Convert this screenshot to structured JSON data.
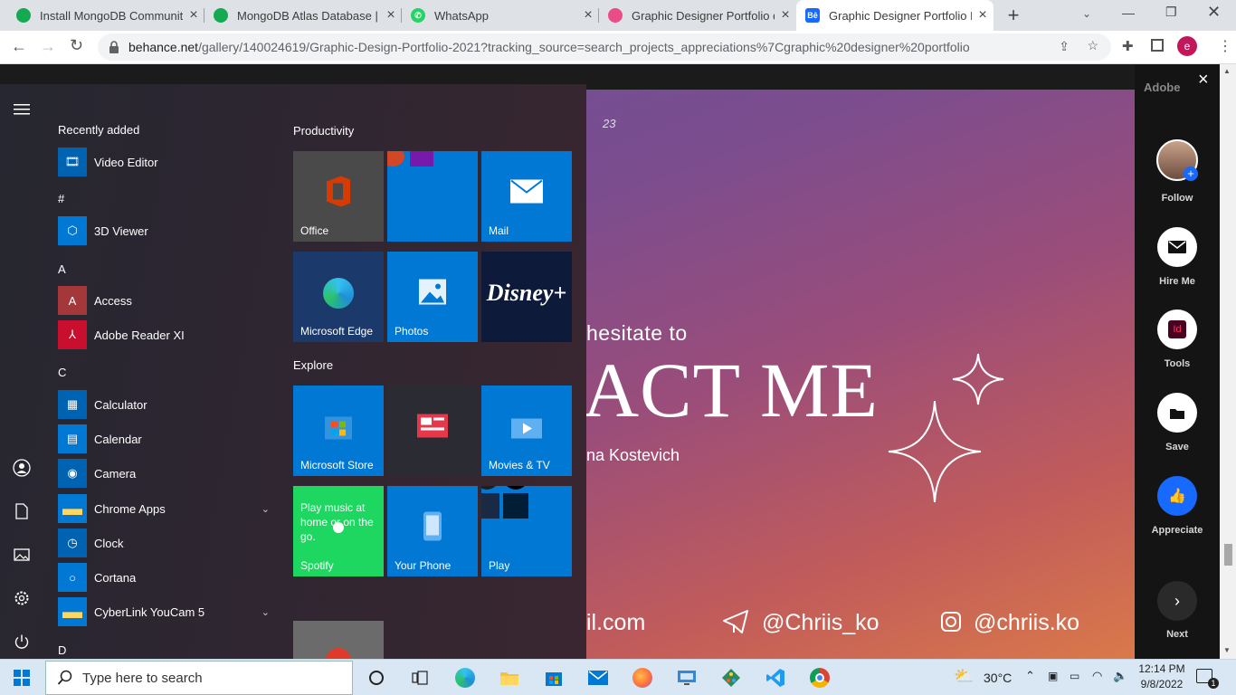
{
  "browser": {
    "tabs": [
      {
        "title": "Install MongoDB Community",
        "icon": "mongodb-leaf-icon",
        "color": "#13aa52"
      },
      {
        "title": "MongoDB Atlas Database | M",
        "icon": "mongodb-leaf-icon",
        "color": "#13aa52"
      },
      {
        "title": "WhatsApp",
        "icon": "whatsapp-icon",
        "color": "#25d366"
      },
      {
        "title": "Graphic Designer Portfolio d",
        "icon": "dribbble-icon",
        "color": "#ea4c89"
      },
      {
        "title": "Graphic Designer Portfolio P",
        "icon": "behance-icon",
        "color": "#1769ff"
      }
    ],
    "url_host": "behance.net",
    "url_path": "/gallery/140024619/Graphic-Design-Portfolio-2021?tracking_source=search_projects_appreciations%7Cgraphic%20designer%20portfolio",
    "profile_initial": "e",
    "profile_color": "#c2185b"
  },
  "artwork": {
    "page_number": "23",
    "line1": "hesitate to",
    "line2": "ACT ME",
    "name": "na Kostevich",
    "email": "il.com",
    "telegram": "@Chriis_ko",
    "instagram": "@chriis.ko"
  },
  "behance_panel": {
    "close": "×",
    "adobe_label": "Adobe",
    "follow": "Follow",
    "hire": "Hire Me",
    "tools": "Tools",
    "tools_badge": "Id",
    "save": "Save",
    "appreciate": "Appreciate",
    "next": "Next"
  },
  "start_menu": {
    "recently_added": "Recently added",
    "apps": [
      {
        "type": "app",
        "label": "Video Editor",
        "icon": "video-editor-icon",
        "color": "#0063b1"
      },
      {
        "type": "letter",
        "label": "#"
      },
      {
        "type": "app",
        "label": "3D Viewer",
        "icon": "cube-icon",
        "color": "#0078d4"
      },
      {
        "type": "letter",
        "label": "A"
      },
      {
        "type": "app",
        "label": "Access",
        "icon": "access-icon",
        "color": "#a4373a"
      },
      {
        "type": "app",
        "label": "Adobe Reader XI",
        "icon": "pdf-icon",
        "color": "#c8102e"
      },
      {
        "type": "letter",
        "label": "C"
      },
      {
        "type": "app",
        "label": "Calculator",
        "icon": "calculator-icon",
        "color": "#0063b1"
      },
      {
        "type": "app",
        "label": "Calendar",
        "icon": "calendar-icon",
        "color": "#0078d4"
      },
      {
        "type": "app",
        "label": "Camera",
        "icon": "camera-icon",
        "color": "#0063b1"
      },
      {
        "type": "app",
        "label": "Chrome Apps",
        "icon": "folder-icon",
        "color": "#0078d4",
        "expand": true
      },
      {
        "type": "app",
        "label": "Clock",
        "icon": "clock-icon",
        "color": "#0063b1"
      },
      {
        "type": "app",
        "label": "Cortana",
        "icon": "cortana-icon",
        "color": "#0078d4"
      },
      {
        "type": "app",
        "label": "CyberLink YouCam 5",
        "icon": "folder-icon",
        "color": "#0078d4",
        "expand": true
      },
      {
        "type": "letter",
        "label": "D"
      }
    ],
    "groups": {
      "productivity": "Productivity",
      "explore": "Explore"
    },
    "tiles": [
      {
        "label": "Office",
        "icon": "office-icon",
        "color": "#4a4a4a"
      },
      {
        "label": "",
        "icon": "office-apps-icon",
        "color": "#0078d4"
      },
      {
        "label": "Mail",
        "icon": "mail-icon",
        "color": "#0078d4"
      },
      {
        "label": "Microsoft Edge",
        "icon": "edge-icon",
        "color": "#1b3a6b"
      },
      {
        "label": "Photos",
        "icon": "photos-icon",
        "color": "#0078d4"
      },
      {
        "label": "",
        "icon": "disney-plus-icon",
        "color": "#0e1a3a"
      },
      {
        "label": "Microsoft Store",
        "icon": "store-icon",
        "color": "#0078d4"
      },
      {
        "label": "",
        "icon": "news-icon",
        "color": "#2b2b33"
      },
      {
        "label": "Movies & TV",
        "icon": "movies-icon",
        "color": "#0078d4"
      },
      {
        "label": "Spotify",
        "icon": "spotify-icon",
        "color": "#1ed760",
        "text": "Play music at home or on the go."
      },
      {
        "label": "Your Phone",
        "icon": "phone-icon",
        "color": "#0078d4"
      },
      {
        "label": "Play",
        "icon": "games-icon",
        "color": "#0078d4"
      }
    ]
  },
  "taskbar": {
    "search_placeholder": "Type here to search",
    "weather": "30°C",
    "time": "12:14 PM",
    "date": "9/8/2022",
    "notifications": "1"
  }
}
